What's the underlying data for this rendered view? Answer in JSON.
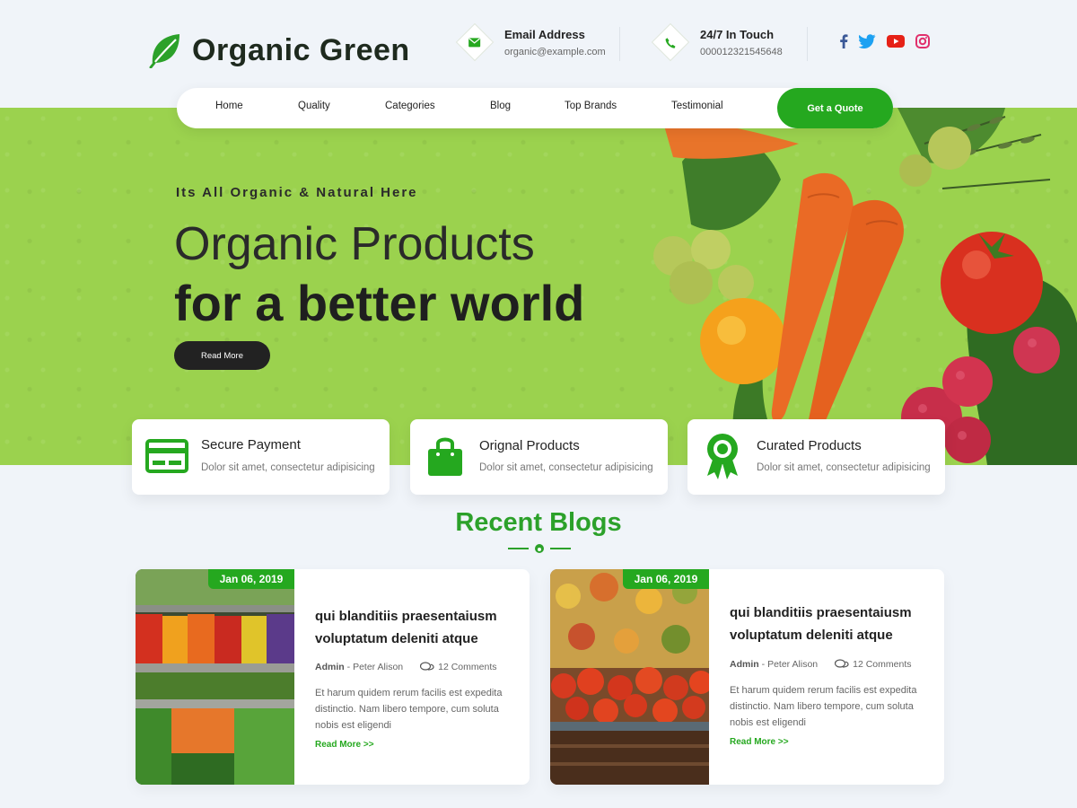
{
  "brand": {
    "name": "Organic Green",
    "accent": "#25a81f",
    "hero_bg": "#9bd24e"
  },
  "contacts": [
    {
      "title": "Email Address",
      "value": "organic@example.com",
      "icon": "mail-icon"
    },
    {
      "title": "24/7 In Touch",
      "value": "000012321545648",
      "icon": "phone-icon"
    }
  ],
  "social": [
    "facebook-icon",
    "twitter-icon",
    "youtube-icon",
    "instagram-icon"
  ],
  "nav": {
    "items": [
      "Home",
      "Quality",
      "Categories",
      "Blog",
      "Top Brands",
      "Testimonial"
    ],
    "cta": "Get a Quote"
  },
  "hero": {
    "tagline": "Its All Organic & Natural Here",
    "headline_line1": "Organic Products",
    "headline_line2": "for a better world",
    "button": "Read More"
  },
  "features": [
    {
      "title": "Secure Payment",
      "desc": "Dolor sit amet, consectetur adipisicing",
      "icon": "credit-card-icon"
    },
    {
      "title": "Orignal Products",
      "desc": "Dolor sit amet, consectetur adipisicing",
      "icon": "shopping-bag-icon"
    },
    {
      "title": "Curated Products",
      "desc": "Dolor sit amet, consectetur adipisicing",
      "icon": "award-ribbon-icon"
    }
  ],
  "blogs_section": {
    "title": "Recent Blogs"
  },
  "blogs": [
    {
      "date": "Jan 06, 2019",
      "title": "qui blanditiis praesentaiusm voluptatum deleniti atque",
      "author": "Admin",
      "author_sep": " - Peter Alison",
      "comments": "12 Comments",
      "excerpt": "Et harum quidem rerum facilis est expedita distinctio. Nam libero tempore, cum soluta nobis est eligendi",
      "read_more": "Read More >>"
    },
    {
      "date": "Jan 06, 2019",
      "title": "qui blanditiis praesentaiusm voluptatum deleniti atque",
      "author": "Admin",
      "author_sep": " - Peter Alison",
      "comments": "12 Comments",
      "excerpt": "Et harum quidem rerum facilis est expedita distinctio. Nam libero tempore, cum soluta nobis est eligendi",
      "read_more": "Read More >>"
    }
  ]
}
